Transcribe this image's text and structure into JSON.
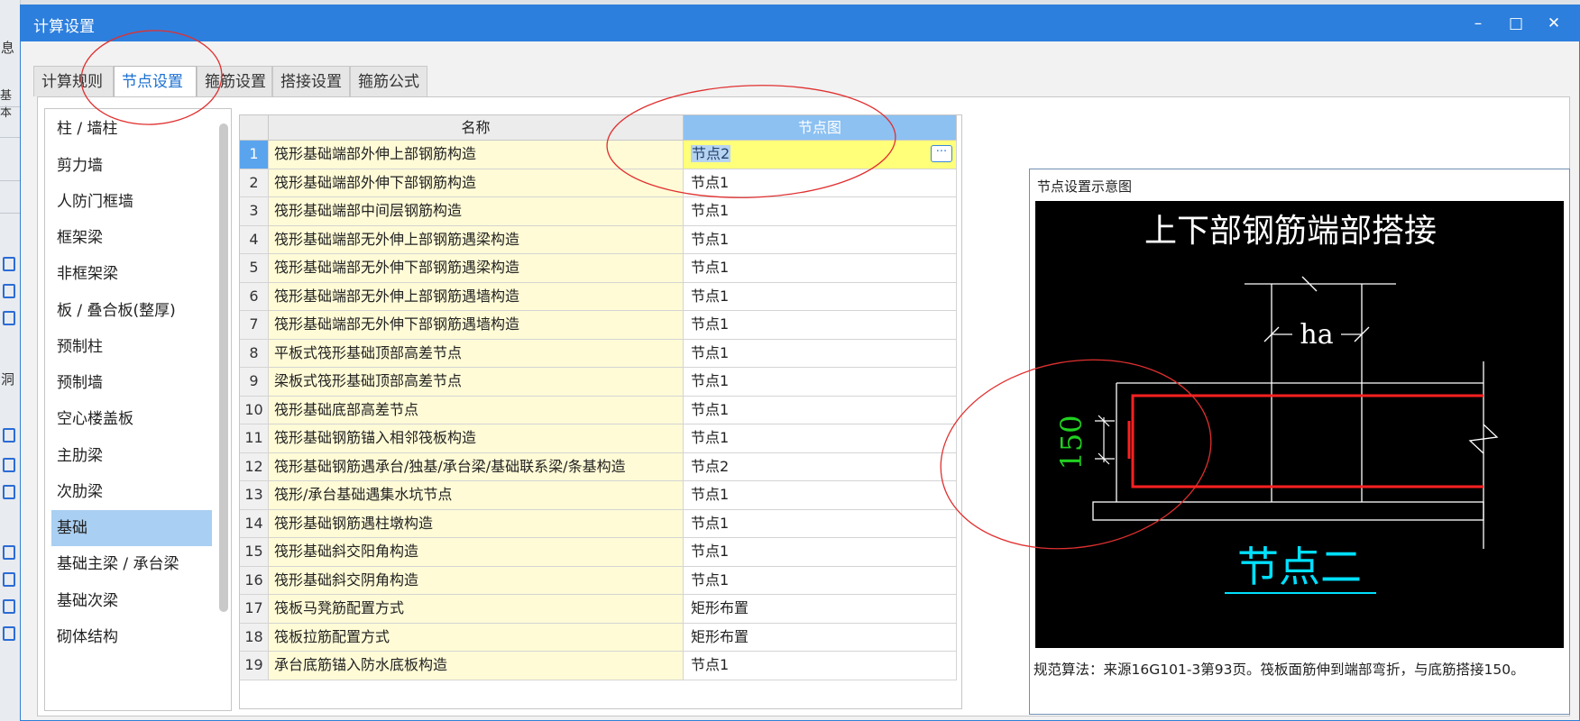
{
  "background_app": {
    "side_labels": [
      "息",
      "基本",
      "洞"
    ]
  },
  "dialog": {
    "title": "计算设置",
    "window_buttons": {
      "minimize": "–",
      "maximize": "□",
      "close": "✕"
    },
    "tabs": [
      {
        "label": "计算规则"
      },
      {
        "label": "节点设置",
        "active": true
      },
      {
        "label": "箍筋设置"
      },
      {
        "label": "搭接设置"
      },
      {
        "label": "箍筋公式"
      }
    ]
  },
  "categories": [
    {
      "label": "柱 / 墙柱"
    },
    {
      "label": "剪力墙"
    },
    {
      "label": "人防门框墙"
    },
    {
      "label": "框架梁"
    },
    {
      "label": "非框架梁"
    },
    {
      "label": "板 / 叠合板(整厚)"
    },
    {
      "label": "预制柱"
    },
    {
      "label": "预制墙"
    },
    {
      "label": "空心楼盖板"
    },
    {
      "label": "主肋梁"
    },
    {
      "label": "次肋梁"
    },
    {
      "label": "基础",
      "selected": true
    },
    {
      "label": "基础主梁 / 承台梁"
    },
    {
      "label": "基础次梁"
    },
    {
      "label": "砌体结构"
    }
  ],
  "grid": {
    "columns": {
      "name": "名称",
      "node": "节点图"
    },
    "rows": [
      {
        "num": "1",
        "name": "筏形基础端部外伸上部钢筋构造",
        "node": "节点2",
        "selected": true
      },
      {
        "num": "2",
        "name": "筏形基础端部外伸下部钢筋构造",
        "node": "节点1"
      },
      {
        "num": "3",
        "name": "筏形基础端部中间层钢筋构造",
        "node": "节点1"
      },
      {
        "num": "4",
        "name": "筏形基础端部无外伸上部钢筋遇梁构造",
        "node": "节点1"
      },
      {
        "num": "5",
        "name": "筏形基础端部无外伸下部钢筋遇梁构造",
        "node": "节点1"
      },
      {
        "num": "6",
        "name": "筏形基础端部无外伸上部钢筋遇墙构造",
        "node": "节点1"
      },
      {
        "num": "7",
        "name": "筏形基础端部无外伸下部钢筋遇墙构造",
        "node": "节点1"
      },
      {
        "num": "8",
        "name": "平板式筏形基础顶部高差节点",
        "node": "节点1"
      },
      {
        "num": "9",
        "name": "梁板式筏形基础顶部高差节点",
        "node": "节点1"
      },
      {
        "num": "10",
        "name": "筏形基础底部高差节点",
        "node": "节点1"
      },
      {
        "num": "11",
        "name": "筏形基础钢筋锚入相邻筏板构造",
        "node": "节点1"
      },
      {
        "num": "12",
        "name": "筏形基础钢筋遇承台/独基/承台梁/基础联系梁/条基构造",
        "node": "节点2"
      },
      {
        "num": "13",
        "name": "筏形/承台基础遇集水坑节点",
        "node": "节点1"
      },
      {
        "num": "14",
        "name": "筏形基础钢筋遇柱墩构造",
        "node": "节点1"
      },
      {
        "num": "15",
        "name": "筏形基础斜交阳角构造",
        "node": "节点1"
      },
      {
        "num": "16",
        "name": "筏形基础斜交阴角构造",
        "node": "节点1"
      },
      {
        "num": "17",
        "name": "筏板马凳筋配置方式",
        "node": "矩形布置"
      },
      {
        "num": "18",
        "name": "筏板拉筋配置方式",
        "node": "矩形布置"
      },
      {
        "num": "19",
        "name": "承台底筋锚入防水底板构造",
        "node": "节点1"
      }
    ],
    "ellipsis_button": "···"
  },
  "preview": {
    "label": "节点设置示意图",
    "diagram": {
      "title": "上下部钢筋端部搭接",
      "dim_ha": "ha",
      "dim_150": "150",
      "caption": "节点二"
    },
    "description": "规范算法：来源16G101-3第93页。筏板面筋伸到端部弯折，与底筋搭接150。"
  },
  "colors": {
    "titlebar": "#2d7fdd",
    "active_tab_text": "#1a6fd1",
    "header_node_bg": "#8cc1f2",
    "name_cell_bg": "#fffbd6",
    "selected_node_bg": "#ffff7a",
    "annotation": "#e03030",
    "diagram_rebar": "#ff2020",
    "diagram_dim_green": "#20d020",
    "diagram_caption": "#00e0ff"
  }
}
